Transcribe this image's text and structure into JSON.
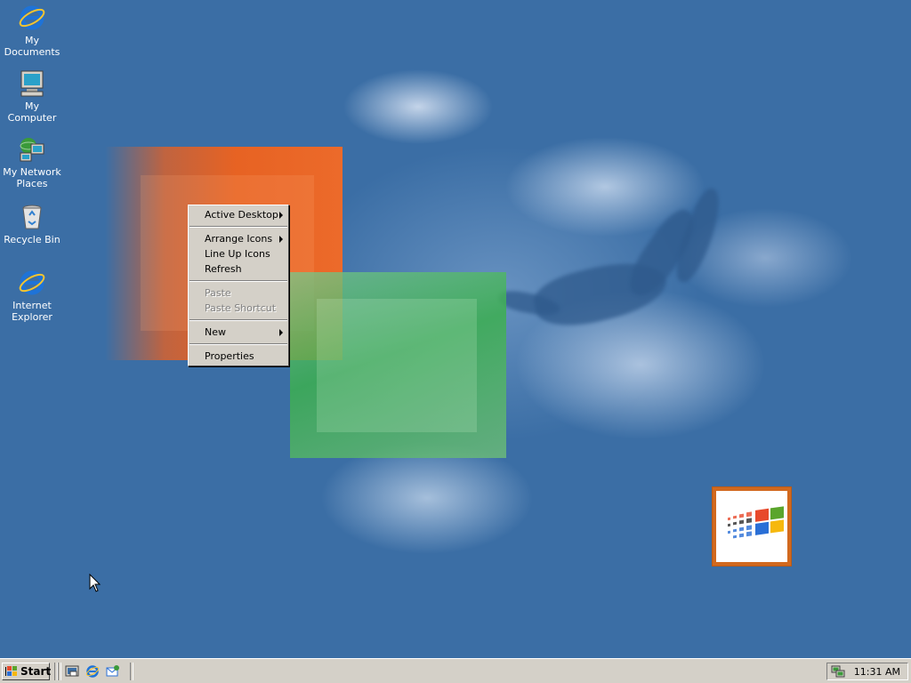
{
  "desktop": {
    "icons": [
      {
        "label": "My Documents",
        "icon": "internet-explorer-icon"
      },
      {
        "label": "My Computer",
        "icon": "computer-icon"
      },
      {
        "label": "My Network Places",
        "icon": "network-places-icon"
      },
      {
        "label": "Recycle Bin",
        "icon": "recycle-bin-icon"
      },
      {
        "label": "Internet Explorer",
        "icon": "internet-explorer-icon"
      }
    ]
  },
  "context_menu": {
    "items": [
      {
        "label": "Active Desktop",
        "submenu": true,
        "enabled": true
      },
      {
        "label": "Arrange Icons",
        "submenu": true,
        "enabled": true
      },
      {
        "label": "Line Up Icons",
        "submenu": false,
        "enabled": true
      },
      {
        "label": "Refresh",
        "submenu": false,
        "enabled": true
      },
      {
        "label": "Paste",
        "submenu": false,
        "enabled": false
      },
      {
        "label": "Paste Shortcut",
        "submenu": false,
        "enabled": false
      },
      {
        "label": "New",
        "submenu": true,
        "enabled": true
      },
      {
        "label": "Properties",
        "submenu": false,
        "enabled": true
      }
    ]
  },
  "taskbar": {
    "start_label": "Start",
    "quick_launch": [
      "show-desktop-icon",
      "internet-explorer-icon",
      "outlook-express-icon"
    ],
    "clock": "11:31 AM",
    "tray_icons": [
      "network-status-icon"
    ]
  },
  "colors": {
    "desktop_bg": "#3b6ea5",
    "face": "#d4d0c8",
    "disabled_text": "#808080"
  }
}
